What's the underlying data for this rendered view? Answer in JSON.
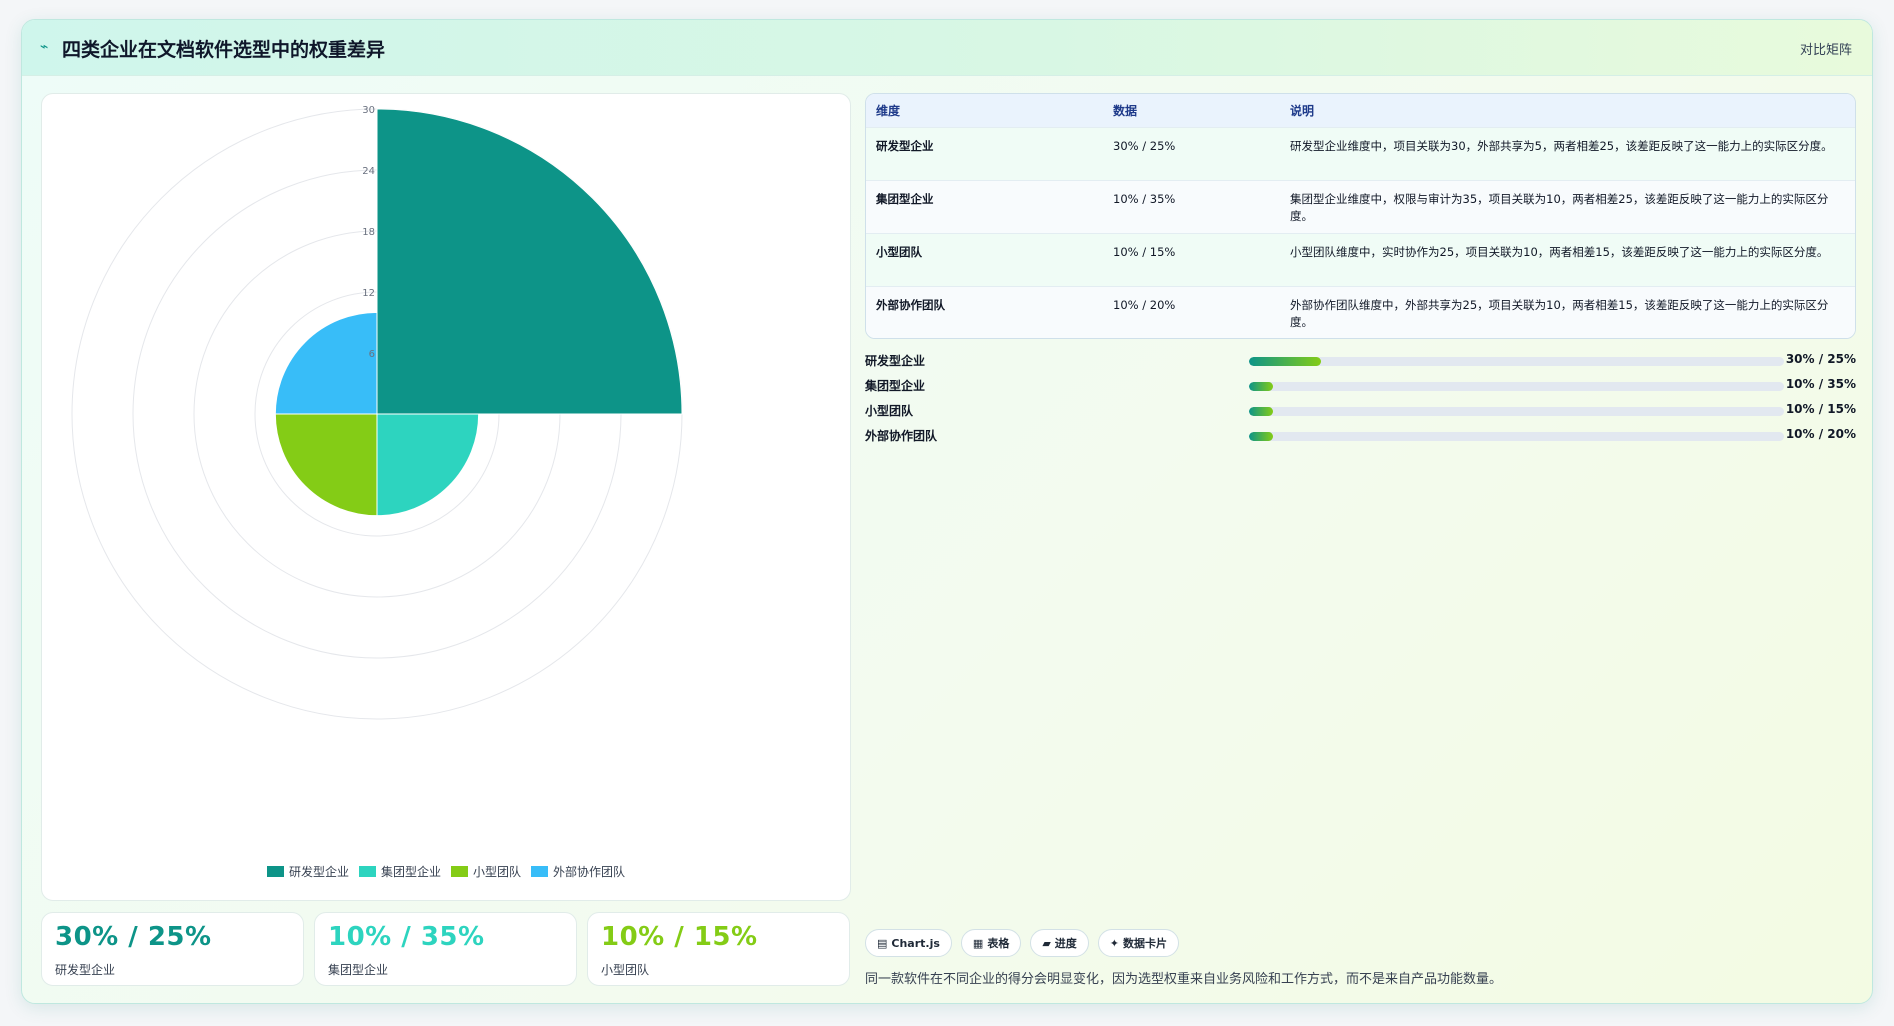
{
  "header": {
    "icon": "chart-trend-icon",
    "title": "四类企业在文档软件选型中的权重差异",
    "right_link": "对比矩阵"
  },
  "legend": [
    {
      "label": "研发型企业",
      "color": "#0d9488"
    },
    {
      "label": "集团型企业",
      "color": "#2dd4bf"
    },
    {
      "label": "小型团队",
      "color": "#84cc16"
    },
    {
      "label": "外部协作团队",
      "color": "#38bdf8"
    }
  ],
  "chart_data": {
    "type": "polarArea",
    "categories": [
      "研发型企业",
      "集团型企业",
      "小型团队",
      "外部协作团队"
    ],
    "values": [
      30,
      10,
      10,
      10
    ],
    "colors": [
      "#0d9488",
      "#2dd4bf",
      "#84cc16",
      "#38bdf8"
    ],
    "rlim": [
      0,
      30
    ],
    "grid": true,
    "legend_position": "bottom"
  },
  "stats": [
    {
      "value": "30% / 25%",
      "label": "研发型企业",
      "color": "#0d9488"
    },
    {
      "value": "10% / 35%",
      "label": "集团型企业",
      "color": "#2dd4bf"
    },
    {
      "value": "10% / 15%",
      "label": "小型团队",
      "color": "#84cc16"
    }
  ],
  "table": {
    "headers": [
      "维度",
      "数据",
      "说明"
    ],
    "rows": [
      {
        "name": "研发型企业",
        "data": "30% / 25%",
        "desc": "研发型企业维度中，项目关联为30，外部共享为5，两者相差25，该差距反映了这一能力上的实际区分度。"
      },
      {
        "name": "集团型企业",
        "data": "10% / 35%",
        "desc": "集团型企业维度中，权限与审计为35，项目关联为10，两者相差25，该差距反映了这一能力上的实际区分度。"
      },
      {
        "name": "小型团队",
        "data": "10% / 15%",
        "desc": "小型团队维度中，实时协作为25，项目关联为10，两者相差15，该差距反映了这一能力上的实际区分度。"
      },
      {
        "name": "外部协作团队",
        "data": "10% / 20%",
        "desc": "外部协作团队维度中，外部共享为25，项目关联为10，两者相差15，该差距反映了这一能力上的实际区分度。"
      }
    ]
  },
  "progress": [
    {
      "label": "研发型企业",
      "value": "30% / 25%",
      "fraction": 0.135
    },
    {
      "label": "集团型企业",
      "value": "10% / 35%",
      "fraction": 0.045
    },
    {
      "label": "小型团队",
      "value": "10% / 15%",
      "fraction": 0.045
    },
    {
      "label": "外部协作团队",
      "value": "10% / 20%",
      "fraction": 0.045
    }
  ],
  "chips": [
    {
      "icon": "chart-icon",
      "glyph": "▤",
      "label": "Chart.js"
    },
    {
      "icon": "table-icon",
      "glyph": "▦",
      "label": "表格"
    },
    {
      "icon": "progress-icon",
      "glyph": "▰",
      "label": "进度"
    },
    {
      "icon": "card-icon",
      "glyph": "✦",
      "label": "数据卡片"
    }
  ],
  "footnote": "同一款软件在不同企业的得分会明显变化，因为选型权重来自业务风险和工作方式，而不是来自产品功能数量。"
}
